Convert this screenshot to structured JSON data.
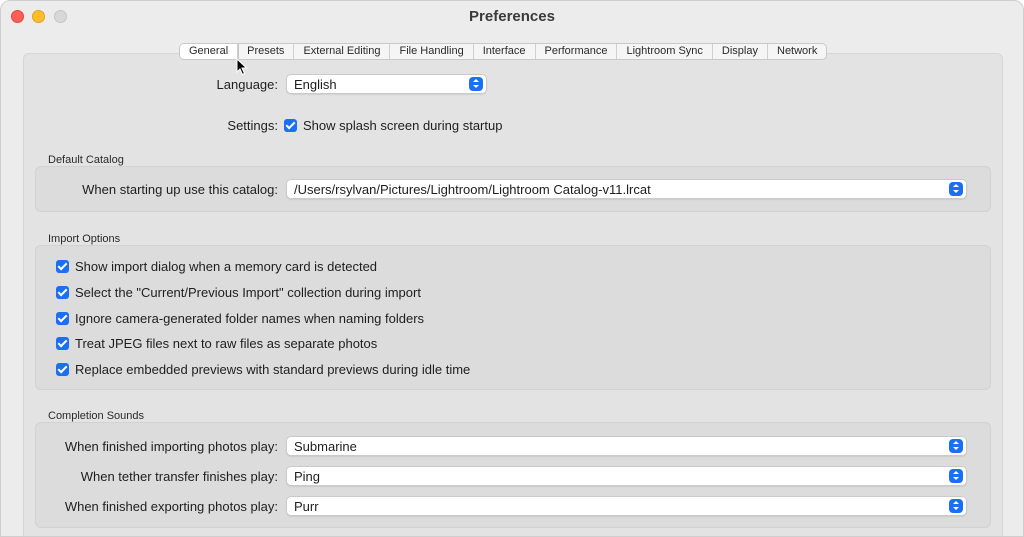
{
  "window": {
    "title": "Preferences"
  },
  "tabs": [
    {
      "label": "General",
      "active": true
    },
    {
      "label": "Presets"
    },
    {
      "label": "External Editing"
    },
    {
      "label": "File Handling"
    },
    {
      "label": "Interface"
    },
    {
      "label": "Performance"
    },
    {
      "label": "Lightroom Sync"
    },
    {
      "label": "Display"
    },
    {
      "label": "Network"
    }
  ],
  "general": {
    "language_label": "Language:",
    "language_value": "English",
    "settings_label": "Settings:",
    "splash_label": "Show splash screen during startup"
  },
  "default_catalog": {
    "section_title": "Default Catalog",
    "label": "When starting up use this catalog:",
    "value": "/Users/rsylvan/Pictures/Lightroom/Lightroom Catalog-v11.lrcat"
  },
  "import_options": {
    "section_title": "Import Options",
    "items": [
      "Show import dialog when a memory card is detected",
      "Select the \"Current/Previous Import\" collection during import",
      "Ignore camera-generated folder names when naming folders",
      "Treat JPEG files next to raw files as separate photos",
      "Replace embedded previews with standard previews during idle time"
    ]
  },
  "completion_sounds": {
    "section_title": "Completion Sounds",
    "importing_label": "When finished importing photos play:",
    "importing_value": "Submarine",
    "tether_label": "When tether transfer finishes play:",
    "tether_value": "Ping",
    "exporting_label": "When finished exporting photos play:",
    "exporting_value": "Purr"
  },
  "colors": {
    "accent": "#1a6ff2",
    "close": "#ff5f57",
    "minimize": "#febc2e"
  }
}
